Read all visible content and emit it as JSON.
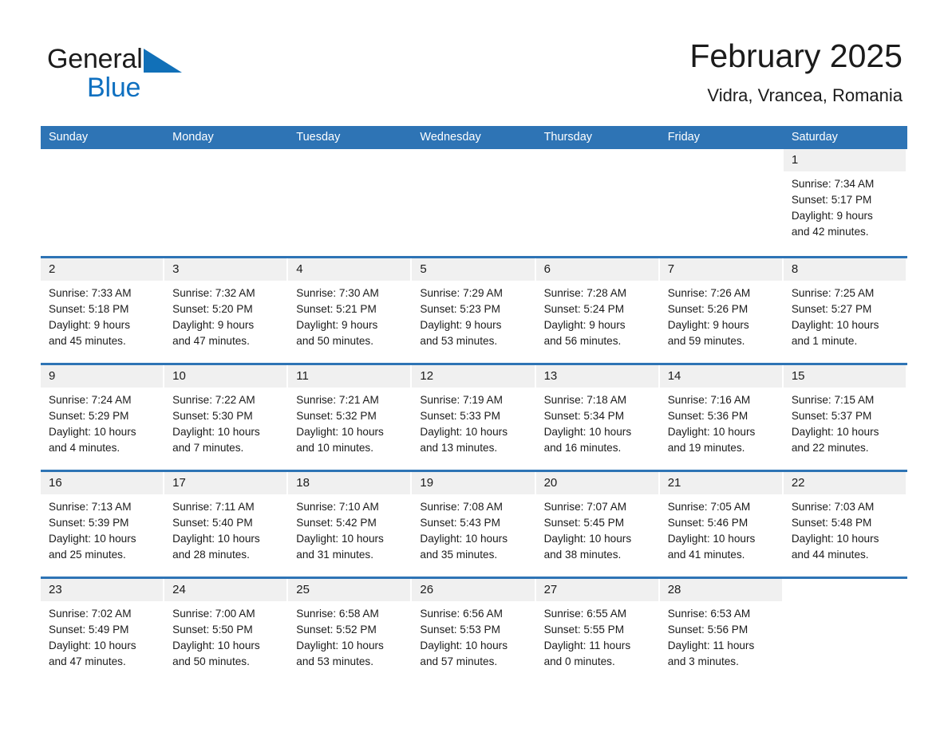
{
  "brand": {
    "name_part1": "General",
    "name_part2": "Blue",
    "triangle_color": "#1170b8",
    "logo_icon": "triangle-flag-icon"
  },
  "header": {
    "title": "February 2025",
    "location": "Vidra, Vrancea, Romania"
  },
  "colors": {
    "header_blue": "#2e74b5",
    "day_strip_gray": "#f0f0f0",
    "text": "#1b1b1b",
    "brand_blue": "#0f70c0"
  },
  "calendar": {
    "weekday_headers": [
      "Sunday",
      "Monday",
      "Tuesday",
      "Wednesday",
      "Thursday",
      "Friday",
      "Saturday"
    ],
    "weeks": [
      [
        {
          "blank": true
        },
        {
          "blank": true
        },
        {
          "blank": true
        },
        {
          "blank": true
        },
        {
          "blank": true
        },
        {
          "blank": true
        },
        {
          "day": "1",
          "sunrise": "Sunrise: 7:34 AM",
          "sunset": "Sunset: 5:17 PM",
          "daylight_line1": "Daylight: 9 hours",
          "daylight_line2": "and 42 minutes."
        }
      ],
      [
        {
          "day": "2",
          "sunrise": "Sunrise: 7:33 AM",
          "sunset": "Sunset: 5:18 PM",
          "daylight_line1": "Daylight: 9 hours",
          "daylight_line2": "and 45 minutes."
        },
        {
          "day": "3",
          "sunrise": "Sunrise: 7:32 AM",
          "sunset": "Sunset: 5:20 PM",
          "daylight_line1": "Daylight: 9 hours",
          "daylight_line2": "and 47 minutes."
        },
        {
          "day": "4",
          "sunrise": "Sunrise: 7:30 AM",
          "sunset": "Sunset: 5:21 PM",
          "daylight_line1": "Daylight: 9 hours",
          "daylight_line2": "and 50 minutes."
        },
        {
          "day": "5",
          "sunrise": "Sunrise: 7:29 AM",
          "sunset": "Sunset: 5:23 PM",
          "daylight_line1": "Daylight: 9 hours",
          "daylight_line2": "and 53 minutes."
        },
        {
          "day": "6",
          "sunrise": "Sunrise: 7:28 AM",
          "sunset": "Sunset: 5:24 PM",
          "daylight_line1": "Daylight: 9 hours",
          "daylight_line2": "and 56 minutes."
        },
        {
          "day": "7",
          "sunrise": "Sunrise: 7:26 AM",
          "sunset": "Sunset: 5:26 PM",
          "daylight_line1": "Daylight: 9 hours",
          "daylight_line2": "and 59 minutes."
        },
        {
          "day": "8",
          "sunrise": "Sunrise: 7:25 AM",
          "sunset": "Sunset: 5:27 PM",
          "daylight_line1": "Daylight: 10 hours",
          "daylight_line2": "and 1 minute."
        }
      ],
      [
        {
          "day": "9",
          "sunrise": "Sunrise: 7:24 AM",
          "sunset": "Sunset: 5:29 PM",
          "daylight_line1": "Daylight: 10 hours",
          "daylight_line2": "and 4 minutes."
        },
        {
          "day": "10",
          "sunrise": "Sunrise: 7:22 AM",
          "sunset": "Sunset: 5:30 PM",
          "daylight_line1": "Daylight: 10 hours",
          "daylight_line2": "and 7 minutes."
        },
        {
          "day": "11",
          "sunrise": "Sunrise: 7:21 AM",
          "sunset": "Sunset: 5:32 PM",
          "daylight_line1": "Daylight: 10 hours",
          "daylight_line2": "and 10 minutes."
        },
        {
          "day": "12",
          "sunrise": "Sunrise: 7:19 AM",
          "sunset": "Sunset: 5:33 PM",
          "daylight_line1": "Daylight: 10 hours",
          "daylight_line2": "and 13 minutes."
        },
        {
          "day": "13",
          "sunrise": "Sunrise: 7:18 AM",
          "sunset": "Sunset: 5:34 PM",
          "daylight_line1": "Daylight: 10 hours",
          "daylight_line2": "and 16 minutes."
        },
        {
          "day": "14",
          "sunrise": "Sunrise: 7:16 AM",
          "sunset": "Sunset: 5:36 PM",
          "daylight_line1": "Daylight: 10 hours",
          "daylight_line2": "and 19 minutes."
        },
        {
          "day": "15",
          "sunrise": "Sunrise: 7:15 AM",
          "sunset": "Sunset: 5:37 PM",
          "daylight_line1": "Daylight: 10 hours",
          "daylight_line2": "and 22 minutes."
        }
      ],
      [
        {
          "day": "16",
          "sunrise": "Sunrise: 7:13 AM",
          "sunset": "Sunset: 5:39 PM",
          "daylight_line1": "Daylight: 10 hours",
          "daylight_line2": "and 25 minutes."
        },
        {
          "day": "17",
          "sunrise": "Sunrise: 7:11 AM",
          "sunset": "Sunset: 5:40 PM",
          "daylight_line1": "Daylight: 10 hours",
          "daylight_line2": "and 28 minutes."
        },
        {
          "day": "18",
          "sunrise": "Sunrise: 7:10 AM",
          "sunset": "Sunset: 5:42 PM",
          "daylight_line1": "Daylight: 10 hours",
          "daylight_line2": "and 31 minutes."
        },
        {
          "day": "19",
          "sunrise": "Sunrise: 7:08 AM",
          "sunset": "Sunset: 5:43 PM",
          "daylight_line1": "Daylight: 10 hours",
          "daylight_line2": "and 35 minutes."
        },
        {
          "day": "20",
          "sunrise": "Sunrise: 7:07 AM",
          "sunset": "Sunset: 5:45 PM",
          "daylight_line1": "Daylight: 10 hours",
          "daylight_line2": "and 38 minutes."
        },
        {
          "day": "21",
          "sunrise": "Sunrise: 7:05 AM",
          "sunset": "Sunset: 5:46 PM",
          "daylight_line1": "Daylight: 10 hours",
          "daylight_line2": "and 41 minutes."
        },
        {
          "day": "22",
          "sunrise": "Sunrise: 7:03 AM",
          "sunset": "Sunset: 5:48 PM",
          "daylight_line1": "Daylight: 10 hours",
          "daylight_line2": "and 44 minutes."
        }
      ],
      [
        {
          "day": "23",
          "sunrise": "Sunrise: 7:02 AM",
          "sunset": "Sunset: 5:49 PM",
          "daylight_line1": "Daylight: 10 hours",
          "daylight_line2": "and 47 minutes."
        },
        {
          "day": "24",
          "sunrise": "Sunrise: 7:00 AM",
          "sunset": "Sunset: 5:50 PM",
          "daylight_line1": "Daylight: 10 hours",
          "daylight_line2": "and 50 minutes."
        },
        {
          "day": "25",
          "sunrise": "Sunrise: 6:58 AM",
          "sunset": "Sunset: 5:52 PM",
          "daylight_line1": "Daylight: 10 hours",
          "daylight_line2": "and 53 minutes."
        },
        {
          "day": "26",
          "sunrise": "Sunrise: 6:56 AM",
          "sunset": "Sunset: 5:53 PM",
          "daylight_line1": "Daylight: 10 hours",
          "daylight_line2": "and 57 minutes."
        },
        {
          "day": "27",
          "sunrise": "Sunrise: 6:55 AM",
          "sunset": "Sunset: 5:55 PM",
          "daylight_line1": "Daylight: 11 hours",
          "daylight_line2": "and 0 minutes."
        },
        {
          "day": "28",
          "sunrise": "Sunrise: 6:53 AM",
          "sunset": "Sunset: 5:56 PM",
          "daylight_line1": "Daylight: 11 hours",
          "daylight_line2": "and 3 minutes."
        },
        {
          "blank": true
        }
      ]
    ]
  }
}
